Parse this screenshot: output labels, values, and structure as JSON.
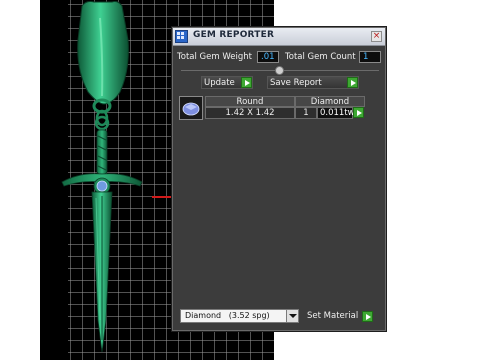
{
  "window": {
    "title": "GEM REPORTER",
    "close_glyph": "×"
  },
  "stats": {
    "total_weight_label": "Total Gem Weight",
    "total_weight_value": ".01",
    "total_count_label": "Total Gem Count",
    "total_count_value": "1"
  },
  "actions": {
    "update_label": "Update",
    "save_report_label": "Save Report"
  },
  "gem_table": {
    "headers": [
      "Round",
      "Diamond"
    ],
    "row": {
      "size": "1.42 X 1.42",
      "count": "1",
      "weight": "0.011tw"
    }
  },
  "material": {
    "selected": "Diamond   (3.52 spg)",
    "set_label": "Set Material"
  },
  "icons": {
    "app": "gem-reporter-app-icon",
    "close": "close-icon",
    "go": "green-arrow-icon",
    "thumb": "round-diamond-thumbnail",
    "dropdown": "chevron-down-icon"
  },
  "colors": {
    "viewport_bg": "#000000",
    "grid": "#969696",
    "model_green": "#1e8a5a",
    "value_text": "#49b8ff",
    "go_button": "#3ea833",
    "axis_red": "#d21a1a"
  }
}
